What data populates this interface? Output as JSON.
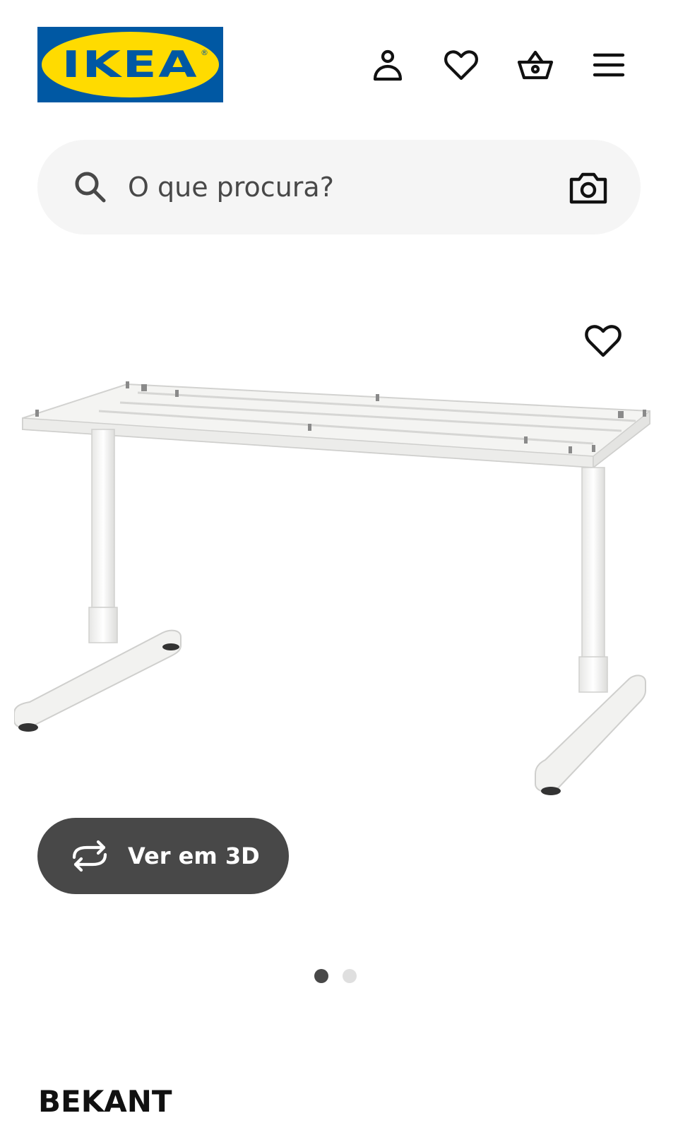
{
  "header": {
    "logo_text": "IKEA",
    "logo_reg": "®",
    "icons": [
      "user-icon",
      "heart-icon",
      "basket-icon",
      "hamburger-menu-icon"
    ]
  },
  "search": {
    "placeholder": "O que procura?",
    "value": "",
    "icons": [
      "search-icon",
      "camera-icon"
    ]
  },
  "gallery": {
    "view_3d_label": "Ver em 3D",
    "image_count": 2,
    "active_index": 0
  },
  "product": {
    "name": "BEKANT"
  },
  "colors": {
    "ikea_blue": "#0058a3",
    "ikea_yellow": "#ffdb00",
    "search_bg": "#f5f5f5",
    "button_dark": "#484848",
    "dot_inactive": "#dfdfdf"
  }
}
